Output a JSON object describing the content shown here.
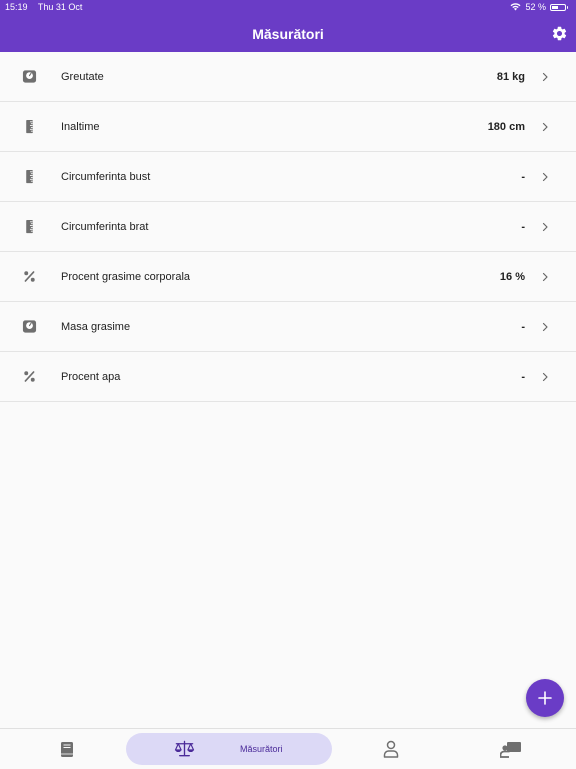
{
  "status": {
    "time": "15:19",
    "date": "Thu 31 Oct",
    "battery": "52 %",
    "battery_level": 0.52
  },
  "header": {
    "title": "Măsurători"
  },
  "rows": [
    {
      "label": "Greutate",
      "value": "81 kg",
      "icon": "scale-icon"
    },
    {
      "label": "Inaltime",
      "value": "180 cm",
      "icon": "ruler-icon"
    },
    {
      "label": "Circumferinta bust",
      "value": "-",
      "icon": "ruler-icon"
    },
    {
      "label": "Circumferinta brat",
      "value": "-",
      "icon": "ruler-icon"
    },
    {
      "label": "Procent grasime corporala",
      "value": "16 %",
      "icon": "percent-icon"
    },
    {
      "label": "Masa grasime",
      "value": "-",
      "icon": "scale-icon"
    },
    {
      "label": "Procent apa",
      "value": "-",
      "icon": "percent-icon"
    }
  ],
  "nav": {
    "active_label": "Măsurători"
  },
  "colors": {
    "primary": "#6a3cc6",
    "nav_active_bg": "#dcd9f6",
    "icon_gray": "#6f6f6f"
  }
}
